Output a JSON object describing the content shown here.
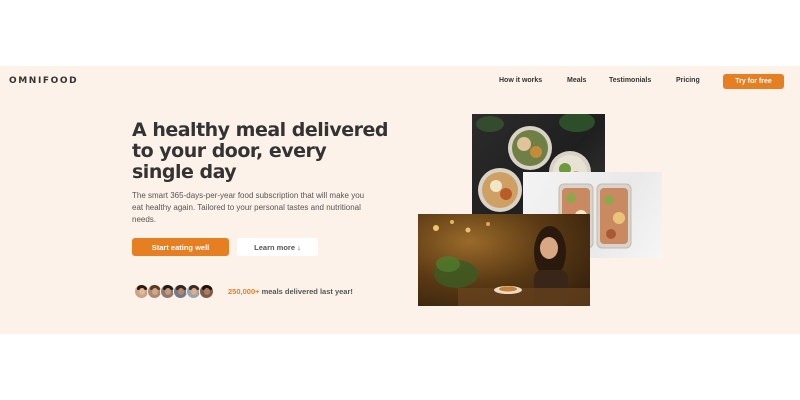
{
  "brand": {
    "logo_text": "OMNIFOOD"
  },
  "nav": {
    "items": [
      "How it works",
      "Meals",
      "Testimonials",
      "Pricing"
    ],
    "cta_label": "Try for free"
  },
  "hero": {
    "headline": "A healthy meal delivered to your door, every single day",
    "description": "The smart 365-days-per-year food subscription that will make you eat healthy again. Tailored to your personal tastes and nutritional needs.",
    "primary_button": "Start eating well",
    "secondary_button": "Learn more ↓",
    "customers": {
      "count_highlight": "250,000+",
      "count_rest": " meals delivered last year!"
    }
  },
  "colors": {
    "accent": "#e67e22",
    "hero_background": "#fdf2e9",
    "text": "#333333"
  },
  "images": [
    "food-bowls-photo",
    "meal-prep-boxes-photo",
    "woman-eating-cafe-photo"
  ]
}
